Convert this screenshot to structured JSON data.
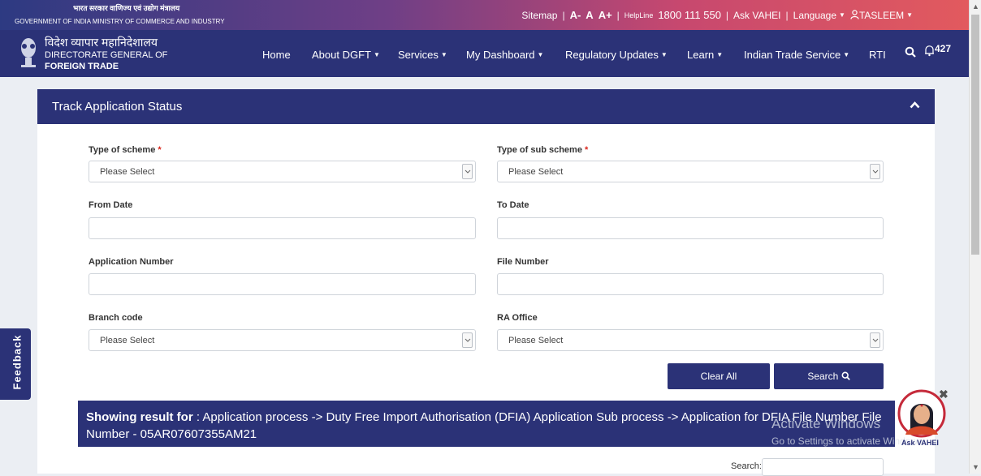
{
  "header": {
    "gov_hindi": "भारत सरकार  वाणिज्य एवं उद्योग मंत्रालय",
    "gov_english": "GOVERNMENT OF INDIA   MINISTRY OF COMMERCE AND INDUSTRY",
    "links": {
      "sitemap": "Sitemap",
      "font_small": "A-",
      "font_normal": "A",
      "font_large": "A+",
      "helpline_label": "HelpLine",
      "helpline_number": "1800 111 550",
      "ask_vahei": "Ask VAHEI",
      "language": "Language",
      "user": "TASLEEM"
    }
  },
  "brand": {
    "hindi": "विदेश व्यापार महानिदेशालय",
    "line1": "DIRECTORATE GENERAL OF",
    "line2": "FOREIGN TRADE"
  },
  "nav": {
    "home": "Home",
    "about": "About DGFT",
    "services": "Services",
    "dashboard": "My Dashboard",
    "regulatory": "Regulatory Updates",
    "learn": "Learn",
    "its": "Indian Trade Service",
    "rti": "RTI",
    "notification_count": "427"
  },
  "form": {
    "title": "Track Application Status",
    "scheme_label": "Type of scheme",
    "subscheme_label": "Type of sub scheme",
    "required_mark": "*",
    "scheme_value": "Please Select",
    "subscheme_value": "Please Select",
    "from_date_label": "From Date",
    "to_date_label": "To Date",
    "from_date_value": "",
    "to_date_value": "",
    "app_number_label": "Application Number",
    "file_number_label": "File Number",
    "app_number_value": "",
    "file_number_value": "",
    "branch_label": "Branch code",
    "ra_label": "RA Office",
    "branch_value": "Please Select",
    "ra_value": "Please Select",
    "clear_all": "Clear All",
    "search": "Search"
  },
  "result": {
    "prefix": "Showing result for",
    "text": " : Application process -> Duty Free Import Authorisation (DFIA) Application Sub process -> Application for DFIA File Number File Number - 05AR07607355AM21"
  },
  "table": {
    "search_label": "Search:",
    "search_value": ""
  },
  "overlay": {
    "watermark_title": "Activate Windows",
    "watermark_sub": "Go to Settings to activate Windows.",
    "feedback": "Feedback",
    "vahei_label": "Ask VAHEI"
  },
  "colors": {
    "navy": "#2b3277",
    "required": "#d9261c"
  },
  "icons": [
    "user-icon",
    "emblem-icon",
    "search-icon",
    "bell-icon",
    "chevron-up-icon",
    "chevron-down-icon",
    "close-icon"
  ]
}
